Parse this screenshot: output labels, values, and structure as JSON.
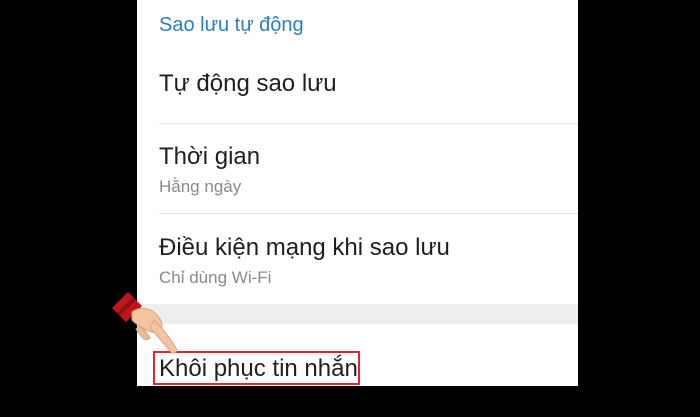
{
  "backup_settings": {
    "section_title": "Sao lưu tự động",
    "rows": [
      {
        "title": "Tự động sao lưu",
        "subtitle": ""
      },
      {
        "title": "Thời gian",
        "subtitle": "Hằng ngày"
      },
      {
        "title": "Điều kiện mạng khi sao lưu",
        "subtitle": "Chỉ dùng Wi-Fi"
      }
    ],
    "restore_label": "Khôi phục tin nhắn"
  },
  "colors": {
    "accent": "#2a7fc6",
    "highlight": "#e5232f",
    "background": "#000000"
  },
  "icons": {
    "pointer": "pointing-hand-icon"
  }
}
